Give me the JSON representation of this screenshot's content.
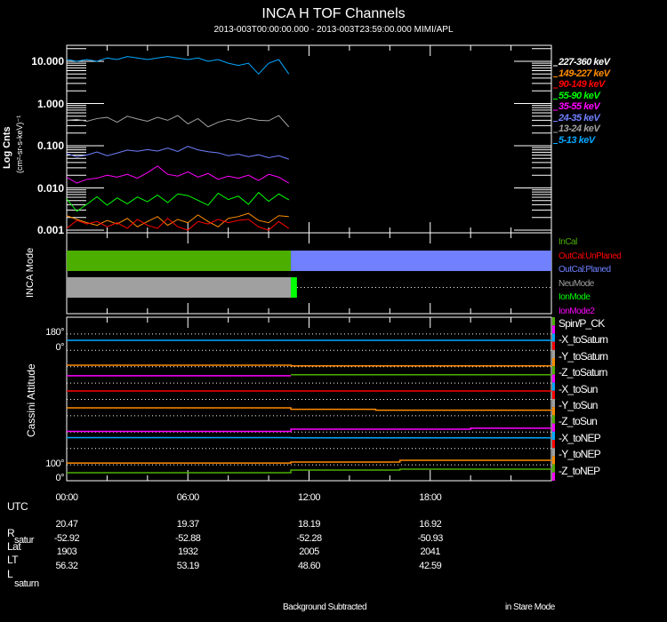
{
  "title": "INCA H TOF Channels",
  "subtitle": "2013-003T00:00:00.000 - 2013-003T23:59:00.000 MIMI/APL",
  "chart_data": [
    {
      "type": "line",
      "name": "tof-channels",
      "ylabel": "Log Cnts",
      "ylabel2": "(cm²-sr-s-keV)⁻¹",
      "yscale": "log",
      "ylim": [
        0.001,
        20
      ],
      "xlim_hours": [
        0,
        24
      ],
      "yticks": [
        "10.000",
        "1.000",
        "0.100",
        "0.010",
        "0.001"
      ],
      "ytick_values": [
        10,
        1,
        0.1,
        0.01,
        0.001
      ],
      "x_hours": [
        0,
        0.5,
        1,
        1.5,
        2,
        2.5,
        3,
        3.5,
        4,
        4.5,
        5,
        5.5,
        6,
        6.5,
        7,
        7.5,
        8,
        8.5,
        9,
        9.5,
        10,
        10.5,
        11
      ],
      "series": [
        {
          "name": "227-360 keV",
          "color": "#ffffff",
          "values": []
        },
        {
          "name": "149-227 keV",
          "color": "#ff8c00",
          "values": [
            0.0022,
            0.0018,
            0.0015,
            0.0013,
            0.0017,
            0.0014,
            0.0019,
            0.0012,
            0.0016,
            0.0021,
            0.0013,
            0.0018,
            0.0015,
            0.0023,
            0.0016,
            0.0012,
            0.0019,
            0.0021,
            0.0025,
            0.0017,
            0.0015,
            0.0022,
            0.0021
          ]
        },
        {
          "name": "90-149 keV",
          "color": "#ff0000",
          "values": [
            0.0011,
            0.0017,
            0.0014,
            0.0016,
            0.0012,
            0.0015,
            0.0011,
            0.0018,
            0.0013,
            0.0011,
            0.0019,
            0.0012,
            0.001,
            0.0016,
            0.0014,
            0.0018,
            0.0015,
            0.0017,
            0.0018,
            0.0012,
            0.001,
            0.0016,
            0.0011
          ]
        },
        {
          "name": "55-90 keV",
          "color": "#00ff00",
          "values": [
            0.0055,
            0.0028,
            0.0041,
            0.0062,
            0.0039,
            0.0058,
            0.0042,
            0.0061,
            0.0047,
            0.0068,
            0.0045,
            0.0072,
            0.0066,
            0.0051,
            0.0039,
            0.0075,
            0.0053,
            0.0064,
            0.0041,
            0.0078,
            0.0048,
            0.0072,
            0.0052
          ]
        },
        {
          "name": "35-55 keV",
          "color": "#ff00ff",
          "values": [
            0.018,
            0.013,
            0.016,
            0.017,
            0.02,
            0.018,
            0.021,
            0.017,
            0.023,
            0.033,
            0.021,
            0.019,
            0.024,
            0.018,
            0.022,
            0.016,
            0.019,
            0.017,
            0.02,
            0.015,
            0.021,
            0.018,
            0.013
          ]
        },
        {
          "name": "24-35 keV",
          "color": "#7080ff",
          "values": [
            0.065,
            0.055,
            0.06,
            0.071,
            0.058,
            0.067,
            0.079,
            0.074,
            0.081,
            0.075,
            0.088,
            0.073,
            0.097,
            0.08,
            0.072,
            0.068,
            0.058,
            0.063,
            0.055,
            0.061,
            0.052,
            0.058,
            0.048
          ]
        },
        {
          "name": "13-24 keV",
          "color": "#a0a0a0",
          "values": [
            0.4,
            0.42,
            0.38,
            0.44,
            0.47,
            0.36,
            0.5,
            0.43,
            0.38,
            0.47,
            0.4,
            0.52,
            0.33,
            0.44,
            0.28,
            0.36,
            0.42,
            0.38,
            0.45,
            0.4,
            0.39,
            0.52,
            0.28
          ]
        },
        {
          "name": "5-13 keV",
          "color": "#00a8ff",
          "values": [
            11,
            10,
            11,
            10,
            12,
            11,
            13,
            12,
            11,
            12,
            13,
            12,
            11,
            12,
            10,
            11,
            9,
            8,
            9,
            5,
            9,
            11,
            5
          ]
        }
      ]
    },
    {
      "type": "bar",
      "name": "inca-mode",
      "ylabel": "INCA Mode",
      "legend": [
        {
          "label": "InCal",
          "color": "#4caf00"
        },
        {
          "label": "OutCal:UnPlaned",
          "color": "#ff0000"
        },
        {
          "label": "OutCal:Planed",
          "color": "#7080ff"
        },
        {
          "label": "NeuMode",
          "color": "#a0a0a0"
        },
        {
          "label": "IonMode",
          "color": "#00ff00"
        },
        {
          "label": "IonMode2",
          "color": "#ff00ff"
        }
      ],
      "rows": [
        {
          "segments": [
            {
              "start": 0,
              "end": 11.1,
              "color": "#4caf00"
            },
            {
              "start": 11.1,
              "end": 24,
              "color": "#7080ff"
            }
          ]
        },
        {
          "segments": [
            {
              "start": 0,
              "end": 11.1,
              "color": "#a0a0a0"
            },
            {
              "start": 11.1,
              "end": 11.4,
              "color": "#00ff00"
            }
          ],
          "dotted_from": 11.4
        }
      ]
    },
    {
      "type": "line",
      "name": "cassini-attitude",
      "ylabel": "Cassini Attitude",
      "yticks": [
        "180°",
        "0°",
        "100°",
        "0°"
      ],
      "panels": [
        "Spin/P_CK",
        "-X_toSaturn",
        "-Y_toSaturn",
        "-Z_toSaturn",
        "-X_toSun",
        "-Y_toSun",
        "-Z_toSun",
        "-X_toNEP",
        "-Y_toNEP",
        "-Z_toNEP"
      ],
      "panel_colors": [
        "#4caf00",
        "#ff00ff",
        "#00a8ff",
        "#ff0000",
        "#a0a0a0",
        "#ff8c00",
        "#4caf00",
        "#ff00ff",
        "#00a8ff",
        "#ff0000",
        "#a0a0a0",
        "#ff8c00",
        "#4caf00",
        "#ff00ff",
        "#00a8ff",
        "#ff0000",
        "#a0a0a0",
        "#ff8c00",
        "#4caf00",
        "#ff00ff"
      ],
      "traces": [
        {
          "panel": 1,
          "color": "#00a8ff",
          "steps": [
            [
              0,
              106
            ],
            [
              24,
              106
            ]
          ]
        },
        {
          "panel": 2,
          "color": "#ff8c00",
          "steps": [
            [
              0,
              12
            ],
            [
              11.1,
              4
            ],
            [
              24,
              4
            ]
          ]
        },
        {
          "panel": 3,
          "color": "#ff00ff",
          "steps": [
            [
              0,
              75
            ],
            [
              11.1,
              75
            ]
          ]
        },
        {
          "panel": 3,
          "color": "#4caf00",
          "steps": [
            [
              11.1,
              86
            ],
            [
              24,
              86
            ]
          ]
        },
        {
          "panel": 4,
          "color": "#ff0000",
          "steps": [
            [
              0,
              88
            ],
            [
              24,
              88
            ]
          ]
        },
        {
          "panel": 5,
          "color": "#ff8c00",
          "steps": [
            [
              0,
              82
            ],
            [
              11.1,
              66
            ],
            [
              15.3,
              56
            ],
            [
              24,
              56
            ]
          ]
        },
        {
          "panel": 6,
          "color": "#ff00ff",
          "steps": [
            [
              0,
              3
            ],
            [
              11.1,
              28
            ],
            [
              20,
              38
            ],
            [
              24,
              38
            ]
          ]
        },
        {
          "panel": 7,
          "color": "#00a8ff",
          "steps": [
            [
              0,
              114
            ],
            [
              11.1,
              112
            ],
            [
              24,
              112
            ]
          ]
        },
        {
          "panel": 8,
          "color": "#ff8c00",
          "steps": [
            [
              0,
              15
            ],
            [
              11.1,
              25
            ],
            [
              16.5,
              45
            ],
            [
              24,
              45
            ]
          ]
        },
        {
          "panel": 9,
          "color": "#4caf00",
          "steps": [
            [
              0,
              88
            ],
            [
              11.1,
              117
            ],
            [
              16.5,
              127
            ],
            [
              24,
              127
            ]
          ]
        }
      ]
    }
  ],
  "time_axis": {
    "label": "UTC",
    "ticks": [
      "00:00",
      "06:00",
      "12:00",
      "18:00"
    ]
  },
  "ephemeris": {
    "labels": [
      {
        "main": "R",
        "sub": "satur"
      },
      {
        "main": "Lat",
        "sub": ""
      },
      {
        "main": "LT",
        "sub": ""
      },
      {
        "main": "L",
        "sub": "saturn"
      }
    ],
    "columns": [
      [
        "20.47",
        "-52.92",
        "1903",
        "56.32"
      ],
      [
        "19.37",
        "-52.88",
        "1932",
        "53.19"
      ],
      [
        "18.19",
        "-52.28",
        "2005",
        "48.60"
      ],
      [
        "16.92",
        "-50.93",
        "2041",
        "42.59"
      ]
    ]
  },
  "footer": {
    "left": "Background Subtracted",
    "right": "in Stare Mode"
  }
}
